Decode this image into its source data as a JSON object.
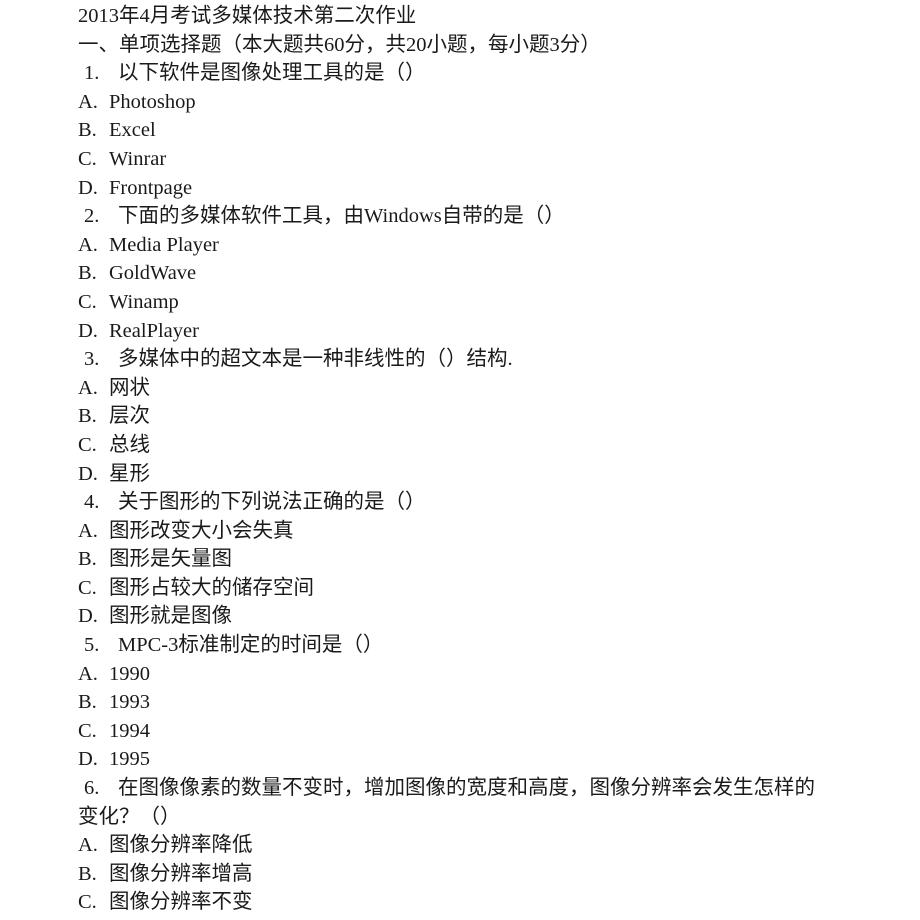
{
  "document": {
    "title": "2013年4月考试多媒体技术第二次作业",
    "section_heading": "一、单项选择题（本大题共60分，共20小题，每小题3分）",
    "questions": [
      {
        "number": "1.",
        "text": "以下软件是图像处理工具的是（）",
        "options": [
          {
            "letter": "A.",
            "text": "Photoshop"
          },
          {
            "letter": "B.",
            "text": "Excel"
          },
          {
            "letter": "C.",
            "text": "Winrar"
          },
          {
            "letter": "D.",
            "text": "Frontpage"
          }
        ]
      },
      {
        "number": "2.",
        "text": "下面的多媒体软件工具，由Windows自带的是（）",
        "options": [
          {
            "letter": "A.",
            "text": "Media Player"
          },
          {
            "letter": "B.",
            "text": "GoldWave"
          },
          {
            "letter": "C.",
            "text": "Winamp"
          },
          {
            "letter": "D.",
            "text": "RealPlayer"
          }
        ]
      },
      {
        "number": "3.",
        "text": "多媒体中的超文本是一种非线性的（）结构.",
        "options": [
          {
            "letter": "A.",
            "text": "网状"
          },
          {
            "letter": "B.",
            "text": "层次"
          },
          {
            "letter": "C.",
            "text": "总线"
          },
          {
            "letter": "D.",
            "text": "星形"
          }
        ]
      },
      {
        "number": "4.",
        "text": "关于图形的下列说法正确的是（）",
        "options": [
          {
            "letter": "A.",
            "text": "图形改变大小会失真"
          },
          {
            "letter": "B.",
            "text": "图形是矢量图"
          },
          {
            "letter": "C.",
            "text": "图形占较大的储存空间"
          },
          {
            "letter": "D.",
            "text": "图形就是图像"
          }
        ]
      },
      {
        "number": "5.",
        "text": "MPC-3标准制定的时间是（）",
        "options": [
          {
            "letter": "A.",
            "text": "1990"
          },
          {
            "letter": "B.",
            "text": "1993"
          },
          {
            "letter": "C.",
            "text": "1994"
          },
          {
            "letter": "D.",
            "text": "1995"
          }
        ]
      },
      {
        "number": "6.",
        "text_line1": "在图像像素的数量不变时，增加图像的宽度和高度，图像分辨率会发生怎样的",
        "text_line2": "变化？（）",
        "options": [
          {
            "letter": "A.",
            "text": "图像分辨率降低"
          },
          {
            "letter": "B.",
            "text": "图像分辨率增高"
          },
          {
            "letter": "C.",
            "text": "图像分辨率不变"
          }
        ]
      }
    ]
  }
}
